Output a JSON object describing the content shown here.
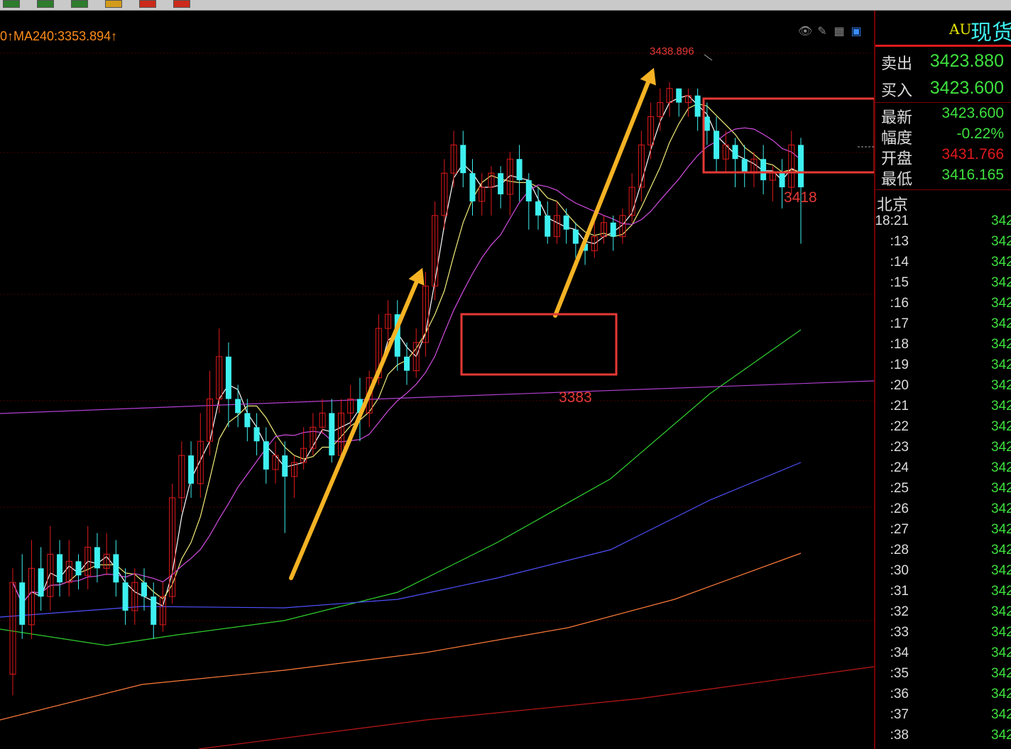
{
  "toolbar": {
    "buttons": [
      {
        "icon": "chart-icon",
        "color": "#2d7d2d"
      },
      {
        "icon": "chart-icon",
        "color": "#2d7d2d"
      },
      {
        "icon": "chart-icon",
        "color": "#2d7d2d"
      },
      {
        "icon": "chart-icon",
        "color": "#d39b1a"
      },
      {
        "icon": "chart-icon",
        "color": "#cc2a1a"
      },
      {
        "icon": "chart-icon",
        "color": "#cc2a1a"
      }
    ]
  },
  "chart": {
    "ma_label": "0↑MA240:3353.894↑",
    "peak_label": "3438.896",
    "annotation_low_1": "3383",
    "annotation_low_2": "3418",
    "icons": [
      "eye-icon",
      "pencil-icon",
      "grid-icon",
      "layout-icon"
    ],
    "colors": {
      "up": "#e0191c",
      "down": "#3ef0f0",
      "arrow": "#f5b324",
      "box": "#e53935"
    }
  },
  "quote": {
    "symbol": "AU",
    "name": "现货",
    "sell_label": "卖出",
    "sell_value": "3423.880",
    "buy_label": "买入",
    "buy_value": "3423.600",
    "latest_label": "最新",
    "latest_value": "3423.600",
    "change_label": "幅度",
    "change_value": "-0.22%",
    "open_label": "开盘",
    "open_value": "3431.766",
    "low_label": "最低",
    "low_value": "3416.165",
    "region_label": "北京"
  },
  "ticks": [
    {
      "time": "18:21",
      "price": "342"
    },
    {
      "time": ":13",
      "price": "342"
    },
    {
      "time": ":14",
      "price": "342"
    },
    {
      "time": ":15",
      "price": "342"
    },
    {
      "time": ":16",
      "price": "342"
    },
    {
      "time": ":17",
      "price": "342"
    },
    {
      "time": ":18",
      "price": "342"
    },
    {
      "time": ":19",
      "price": "342"
    },
    {
      "time": ":20",
      "price": "342"
    },
    {
      "time": ":21",
      "price": "342"
    },
    {
      "time": ":22",
      "price": "342"
    },
    {
      "time": ":23",
      "price": "342"
    },
    {
      "time": ":24",
      "price": "342"
    },
    {
      "time": ":25",
      "price": "342"
    },
    {
      "time": ":26",
      "price": "342"
    },
    {
      "time": ":27",
      "price": "342"
    },
    {
      "time": ":28",
      "price": "342"
    },
    {
      "time": ":30",
      "price": "342"
    },
    {
      "time": ":31",
      "price": "342"
    },
    {
      "time": ":32",
      "price": "342"
    },
    {
      "time": ":33",
      "price": "342"
    },
    {
      "time": ":34",
      "price": "342"
    },
    {
      "time": ":35",
      "price": "342"
    },
    {
      "time": ":36",
      "price": "342"
    },
    {
      "time": ":37",
      "price": "342"
    },
    {
      "time": ":38",
      "price": "342"
    }
  ],
  "candles": [
    [
      3355,
      3368,
      3352,
      3370
    ],
    [
      3368,
      3362,
      3360,
      3372
    ],
    [
      3362,
      3370,
      3360,
      3374
    ],
    [
      3370,
      3366,
      3364,
      3373
    ],
    [
      3366,
      3372,
      3364,
      3376
    ],
    [
      3372,
      3368,
      3366,
      3374
    ],
    [
      3368,
      3371,
      3366,
      3374
    ],
    [
      3371,
      3369,
      3367,
      3372
    ],
    [
      3369,
      3373,
      3367,
      3376
    ],
    [
      3373,
      3370,
      3368,
      3375
    ],
    [
      3370,
      3372,
      3369,
      3375
    ],
    [
      3372,
      3368,
      3366,
      3374
    ],
    [
      3368,
      3364,
      3362,
      3370
    ],
    [
      3364,
      3368,
      3362,
      3370
    ],
    [
      3368,
      3366,
      3364,
      3370
    ],
    [
      3366,
      3362,
      3360,
      3368
    ],
    [
      3362,
      3366,
      3361,
      3368
    ],
    [
      3366,
      3380,
      3365,
      3382
    ],
    [
      3380,
      3386,
      3378,
      3388
    ],
    [
      3386,
      3382,
      3380,
      3388
    ],
    [
      3382,
      3388,
      3380,
      3392
    ],
    [
      3388,
      3394,
      3386,
      3398
    ],
    [
      3394,
      3400,
      3392,
      3404
    ],
    [
      3400,
      3394,
      3390,
      3402
    ],
    [
      3394,
      3392,
      3390,
      3396
    ],
    [
      3392,
      3390,
      3388,
      3394
    ],
    [
      3390,
      3388,
      3386,
      3392
    ],
    [
      3388,
      3384,
      3382,
      3390
    ],
    [
      3384,
      3386,
      3382,
      3388
    ],
    [
      3386,
      3383,
      3375,
      3388
    ],
    [
      3383,
      3385,
      3380,
      3386
    ],
    [
      3385,
      3387,
      3384,
      3390
    ],
    [
      3387,
      3390,
      3386,
      3392
    ],
    [
      3390,
      3392,
      3389,
      3394
    ],
    [
      3392,
      3386,
      3385,
      3394
    ],
    [
      3386,
      3392,
      3385,
      3394
    ],
    [
      3392,
      3394,
      3390,
      3396
    ],
    [
      3394,
      3392,
      3388,
      3397
    ],
    [
      3392,
      3397,
      3390,
      3398
    ],
    [
      3397,
      3404,
      3396,
      3406
    ],
    [
      3404,
      3406,
      3402,
      3408
    ],
    [
      3406,
      3400,
      3398,
      3408
    ],
    [
      3400,
      3398,
      3396,
      3402
    ],
    [
      3398,
      3402,
      3397,
      3404
    ],
    [
      3402,
      3410,
      3400,
      3412
    ],
    [
      3410,
      3420,
      3408,
      3422
    ],
    [
      3420,
      3426,
      3418,
      3428
    ],
    [
      3426,
      3430,
      3424,
      3432
    ],
    [
      3430,
      3426,
      3424,
      3432
    ],
    [
      3426,
      3422,
      3420,
      3428
    ],
    [
      3422,
      3424,
      3420,
      3426
    ],
    [
      3424,
      3426,
      3420,
      3427
    ],
    [
      3426,
      3423,
      3421,
      3427
    ],
    [
      3423,
      3428,
      3420,
      3429
    ],
    [
      3428,
      3425,
      3422,
      3430
    ],
    [
      3425,
      3422,
      3418,
      3426
    ],
    [
      3422,
      3420,
      3418,
      3424
    ],
    [
      3420,
      3417,
      3416,
      3422
    ],
    [
      3417,
      3420,
      3416,
      3422
    ],
    [
      3420,
      3418,
      3416,
      3421
    ],
    [
      3418,
      3416,
      3414,
      3419
    ],
    [
      3416,
      3415,
      3413,
      3417
    ],
    [
      3415,
      3417,
      3414,
      3419
    ],
    [
      3417,
      3419,
      3416,
      3420
    ],
    [
      3419,
      3417,
      3415,
      3420
    ],
    [
      3417,
      3420,
      3416,
      3421
    ],
    [
      3420,
      3424,
      3419,
      3426
    ],
    [
      3424,
      3430,
      3422,
      3432
    ],
    [
      3430,
      3434,
      3428,
      3436
    ],
    [
      3434,
      3436,
      3432,
      3438
    ],
    [
      3436,
      3438,
      3434,
      3438.896
    ],
    [
      3438,
      3436,
      3434,
      3438
    ],
    [
      3436,
      3437,
      3434,
      3438
    ],
    [
      3437,
      3434,
      3432,
      3438
    ],
    [
      3434,
      3432,
      3430,
      3436
    ],
    [
      3432,
      3428,
      3426,
      3434
    ],
    [
      3428,
      3430,
      3426,
      3432
    ],
    [
      3430,
      3428,
      3424,
      3431
    ],
    [
      3428,
      3426,
      3424,
      3430
    ],
    [
      3426,
      3428,
      3424,
      3429
    ],
    [
      3428,
      3425,
      3423,
      3430
    ],
    [
      3425,
      3426,
      3422,
      3427
    ],
    [
      3426,
      3424,
      3421,
      3428
    ],
    [
      3424,
      3430,
      3423,
      3432
    ],
    [
      3430,
      3424,
      3416,
      3431
    ]
  ]
}
